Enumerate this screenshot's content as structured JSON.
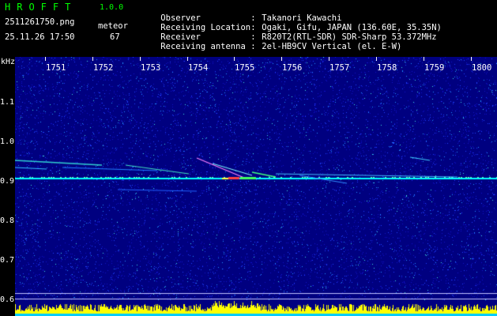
{
  "app": {
    "logo": "HROFFT",
    "version": "1.0.0",
    "filename": "2511261750.png",
    "datetime": "25.11.26 17:50",
    "meteor_label": "meteor",
    "meteor_count": "67"
  },
  "info": [
    {
      "label": "Observer",
      "value": "Takanori Kawachi"
    },
    {
      "label": "Receiving Location",
      "value": "Ogaki, Gifu, JAPAN (136.60E, 35.35N)"
    },
    {
      "label": "Receiver",
      "value": "R820T2(RTL-SDR) SDR-Sharp 53.372MHz"
    },
    {
      "label": "Receiving antenna",
      "value": "2el-HB9CV Vertical (el. E-W)"
    }
  ],
  "axis": {
    "y_unit": "kHz",
    "y_ticks": [
      "1.1",
      "1.0",
      "0.9",
      "0.8",
      "0.7",
      "0.6"
    ],
    "x_ticks": [
      "1751",
      "1752",
      "1753",
      "1754",
      "1755",
      "1756",
      "1757",
      "1758",
      "1759",
      "1800"
    ]
  },
  "colors": {
    "background": "#000080",
    "carrier": "#00ffff",
    "logo": "#00ff00",
    "baseline": "#ffff00",
    "baseline_alt": "#00ccff"
  }
}
